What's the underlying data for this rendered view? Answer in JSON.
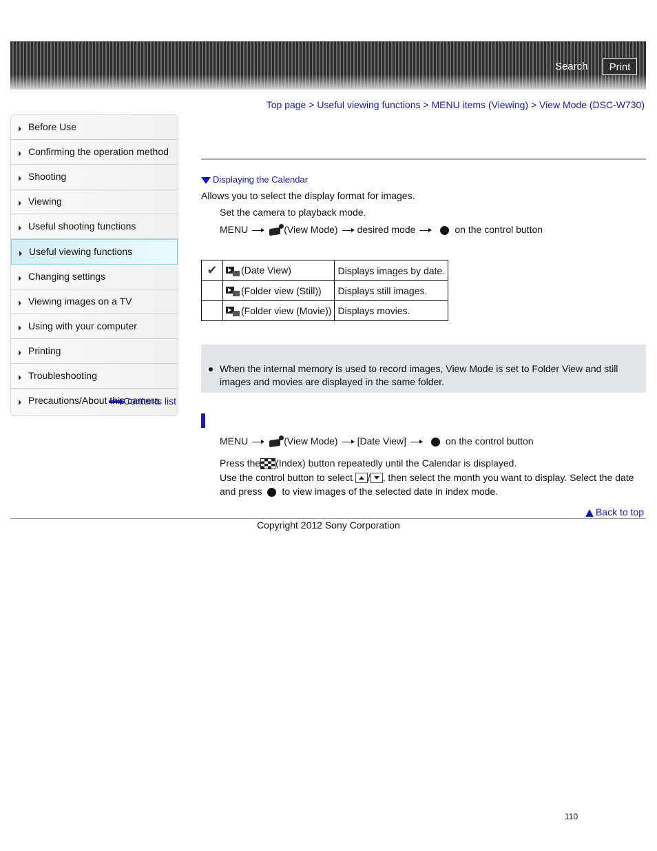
{
  "header": {
    "search_label": "Search",
    "print_label": "Print"
  },
  "breadcrumb": {
    "items": [
      "Top page",
      "Useful viewing functions",
      "MENU items (Viewing)",
      "View Mode (DSC-W730)"
    ],
    "separator": ">"
  },
  "sidebar": {
    "items": [
      {
        "label": "Before Use"
      },
      {
        "label": "Confirming the operation method"
      },
      {
        "label": "Shooting"
      },
      {
        "label": "Viewing"
      },
      {
        "label": "Useful shooting functions"
      },
      {
        "label": "Useful viewing functions",
        "active": true
      },
      {
        "label": "Changing settings"
      },
      {
        "label": "Viewing images on a TV"
      },
      {
        "label": "Using with your computer"
      },
      {
        "label": "Printing"
      },
      {
        "label": "Troubleshooting"
      },
      {
        "label": "Precautions/About this camera"
      }
    ],
    "contents_list_label": "Contents list"
  },
  "main": {
    "anchor_link": "Displaying the Calendar",
    "intro": "Allows you to select the display format for images.",
    "step1": "Set the camera to playback mode.",
    "step2": {
      "menu": "MENU",
      "view_mode": "(View Mode)",
      "target": "desired mode",
      "tail": "on the control button"
    },
    "modes_table": [
      {
        "checked": true,
        "label": "(Date View)",
        "description": "Displays images by date."
      },
      {
        "checked": false,
        "label": "(Folder view (Still))",
        "description": "Displays still images."
      },
      {
        "checked": false,
        "label": "(Folder view (Movie))",
        "description": "Displays movies."
      }
    ],
    "note": "When the internal memory is used to record images, View Mode is set to Folder View and still images and movies are displayed in the same folder.",
    "calendar": {
      "step1": {
        "menu": "MENU",
        "view_mode": "(View Mode)",
        "target": "[Date View]",
        "tail": "on the control button"
      },
      "press_prefix": "Press the",
      "press_suffix": "(Index) button repeatedly until the Calendar is displayed.",
      "use_prefix": "Use the control button to select",
      "use_suffix": ", then select the month you want to display. Select the date",
      "and_press": "and press",
      "and_press_suffix": "to view images of the selected date in index mode."
    },
    "back_to_top": "Back to top"
  },
  "footer": {
    "copyright": "Copyright 2012 Sony Corporation",
    "page_number": "110"
  }
}
